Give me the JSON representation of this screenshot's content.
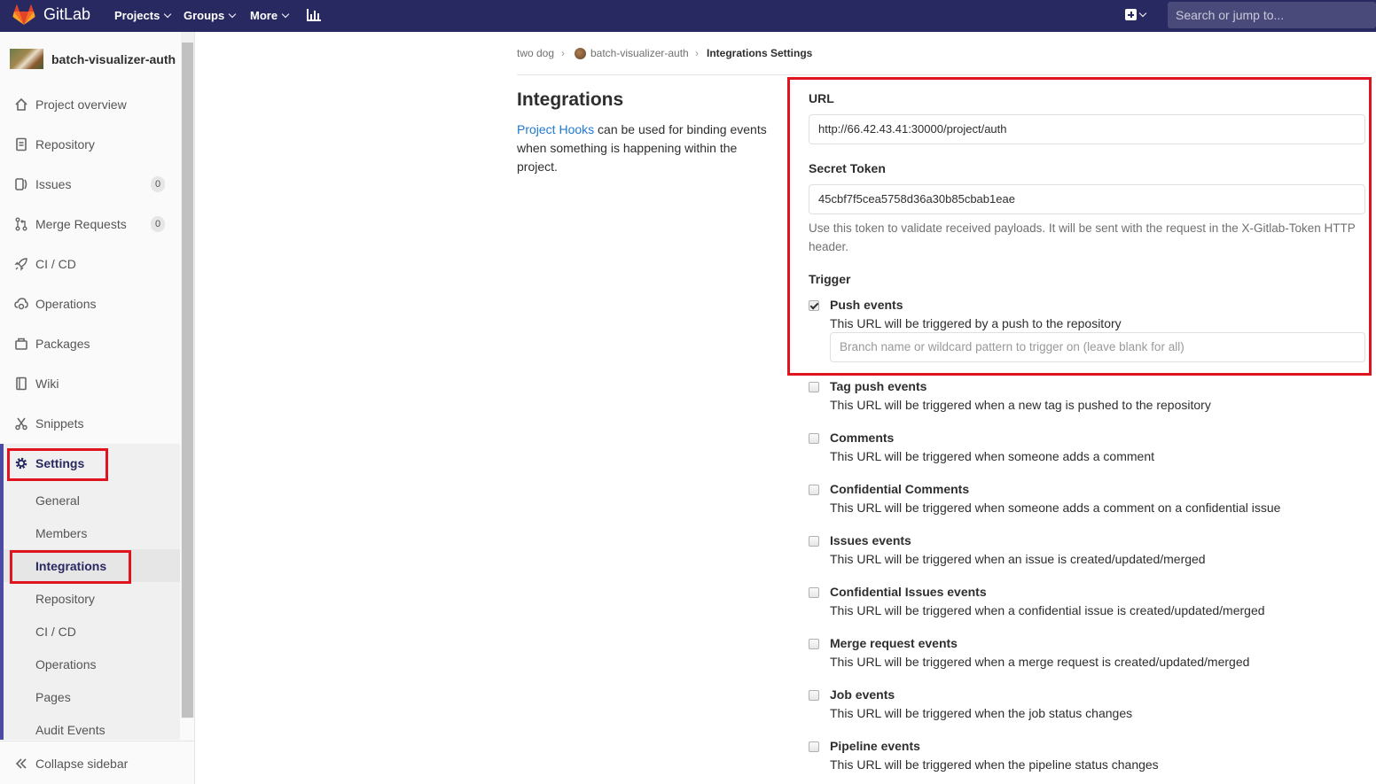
{
  "navbar": {
    "brand": "GitLab",
    "links": [
      "Projects",
      "Groups",
      "More"
    ],
    "search_placeholder": "Search or jump to..."
  },
  "sidebar": {
    "project_name": "batch-visualizer-auth",
    "items": [
      {
        "label": "Project overview",
        "icon": "home-icon"
      },
      {
        "label": "Repository",
        "icon": "doc-icon"
      },
      {
        "label": "Issues",
        "icon": "issues-icon",
        "badge": "0"
      },
      {
        "label": "Merge Requests",
        "icon": "merge-icon",
        "badge": "0"
      },
      {
        "label": "CI / CD",
        "icon": "rocket-icon"
      },
      {
        "label": "Operations",
        "icon": "cloud-gear-icon"
      },
      {
        "label": "Packages",
        "icon": "package-icon"
      },
      {
        "label": "Wiki",
        "icon": "book-icon"
      },
      {
        "label": "Snippets",
        "icon": "scissors-icon"
      },
      {
        "label": "Settings",
        "icon": "gear-icon"
      }
    ],
    "settings_sub": [
      "General",
      "Members",
      "Integrations",
      "Repository",
      "CI / CD",
      "Operations",
      "Pages",
      "Audit Events"
    ],
    "collapse_label": "Collapse sidebar"
  },
  "breadcrumb": [
    "two dog",
    "batch-visualizer-auth",
    "Integrations Settings"
  ],
  "intro": {
    "title": "Integrations",
    "link_text": "Project Hooks",
    "text": " can be used for binding events when something is happening within the project."
  },
  "form": {
    "url_label": "URL",
    "url_value": "http://66.42.43.41:30000/project/auth",
    "token_label": "Secret Token",
    "token_value": "45cbf7f5cea5758d36a30b85cbab1eae",
    "token_help": "Use this token to validate received payloads. It will be sent with the request in the X-Gitlab-Token HTTP header.",
    "trigger_label": "Trigger",
    "branch_placeholder": "Branch name or wildcard pattern to trigger on (leave blank for all)"
  },
  "events": [
    {
      "title": "Push events",
      "desc": "This URL will be triggered by a push to the repository",
      "checked": true
    },
    {
      "title": "Tag push events",
      "desc": "This URL will be triggered when a new tag is pushed to the repository",
      "checked": false
    },
    {
      "title": "Comments",
      "desc": "This URL will be triggered when someone adds a comment",
      "checked": false
    },
    {
      "title": "Confidential Comments",
      "desc": "This URL will be triggered when someone adds a comment on a confidential issue",
      "checked": false
    },
    {
      "title": "Issues events",
      "desc": "This URL will be triggered when an issue is created/updated/merged",
      "checked": false
    },
    {
      "title": "Confidential Issues events",
      "desc": "This URL will be triggered when a confidential issue is created/updated/merged",
      "checked": false
    },
    {
      "title": "Merge request events",
      "desc": "This URL will be triggered when a merge request is created/updated/merged",
      "checked": false
    },
    {
      "title": "Job events",
      "desc": "This URL will be triggered when the job status changes",
      "checked": false
    },
    {
      "title": "Pipeline events",
      "desc": "This URL will be triggered when the pipeline status changes",
      "checked": false
    }
  ],
  "colors": {
    "navbar": "#292961",
    "link": "#1f78d1",
    "highlight": "#e0141e",
    "active_nav": "#4b4ba3"
  }
}
